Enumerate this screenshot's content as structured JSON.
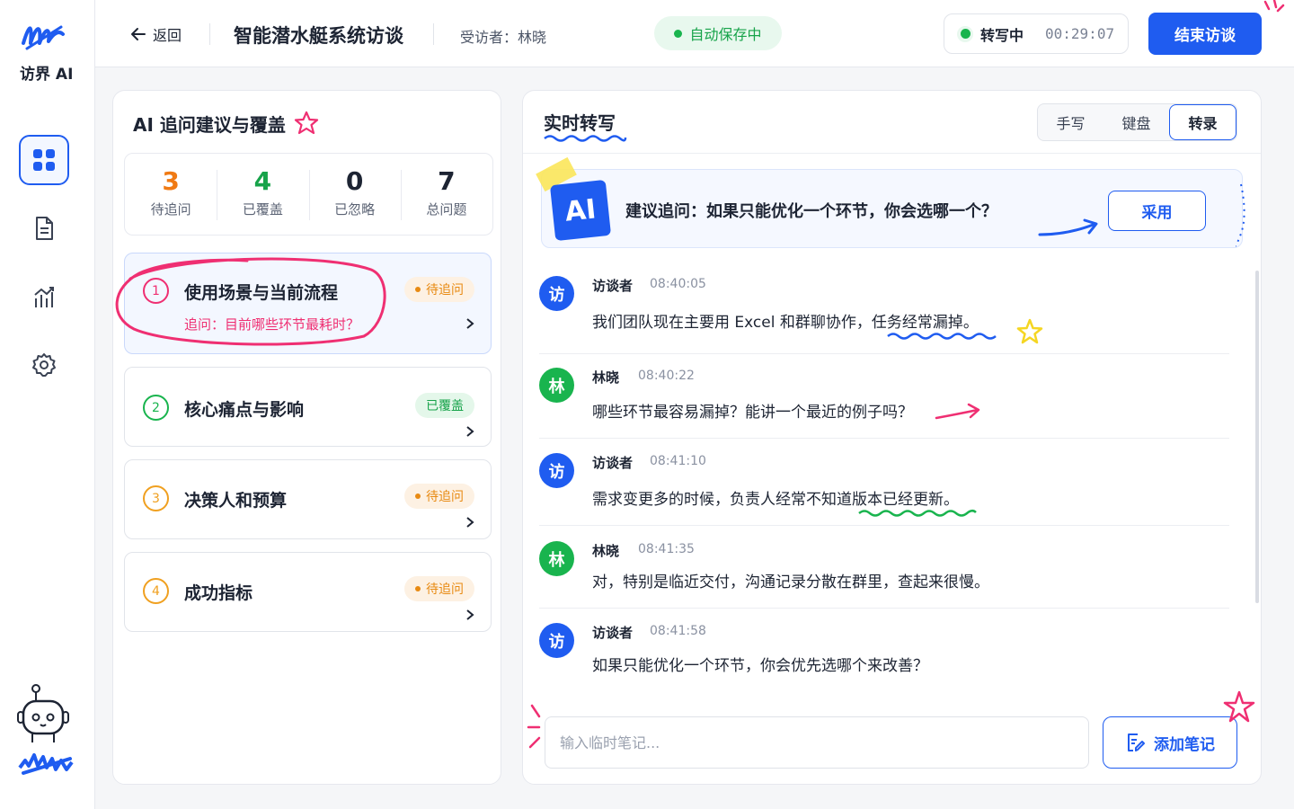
{
  "brand": {
    "name": "访界 AI"
  },
  "sidebar": {
    "items": [
      {
        "icon": "dashboard-icon",
        "active": true
      },
      {
        "icon": "document-icon",
        "active": false
      },
      {
        "icon": "chart-icon",
        "active": false
      },
      {
        "icon": "gear-icon",
        "active": false
      }
    ]
  },
  "topbar": {
    "back_label": "返回",
    "title": "智能潜水艇系统访谈",
    "interviewee": "受访者：林晓",
    "autosave": "自动保存中",
    "recording_label": "转写中",
    "recording_time": "00:29:07",
    "end_button": "结束访谈"
  },
  "coverage": {
    "title": "AI 追问建议与覆盖",
    "stats": [
      {
        "value": "3",
        "label": "待追问",
        "color": "#f07a14"
      },
      {
        "value": "4",
        "label": "已覆盖",
        "color": "#17a34a"
      },
      {
        "value": "0",
        "label": "已忽略",
        "color": "#1d2433"
      },
      {
        "value": "7",
        "label": "总问题",
        "color": "#1d2433"
      }
    ],
    "topics": [
      {
        "num": "1",
        "title": "使用场景与当前流程",
        "sub": "追问：目前哪些环节最耗时？",
        "badge": "待追问",
        "status": "pending",
        "color": "#ef2f72"
      },
      {
        "num": "2",
        "title": "核心痛点与影响",
        "sub": "",
        "badge": "已覆盖",
        "status": "covered",
        "color": "#19b44e"
      },
      {
        "num": "3",
        "title": "决策人和预算",
        "sub": "",
        "badge": "待追问",
        "status": "pending",
        "color": "#f0a020"
      },
      {
        "num": "4",
        "title": "成功指标",
        "sub": "",
        "badge": "待追问",
        "status": "pending",
        "color": "#f0a020"
      }
    ]
  },
  "transcript": {
    "title": "实时转写",
    "modes": [
      {
        "label": "手写",
        "active": false
      },
      {
        "label": "键盘",
        "active": false
      },
      {
        "label": "转录",
        "active": true
      }
    ],
    "suggestion": {
      "badge": "AI",
      "text": "建议追问：如果只能优化一个环节，你会选哪一个？",
      "adopt": "采用"
    },
    "messages": [
      {
        "avatar": "访",
        "name": "访谈者",
        "time": "08:40:05",
        "text": "我们团队现在主要用 Excel 和群聊协作，任务经常漏掉。",
        "side": "interviewer"
      },
      {
        "avatar": "林",
        "name": "林晓",
        "time": "08:40:22",
        "text": "哪些环节最容易漏掉？能讲一个最近的例子吗？",
        "side": "interviewee"
      },
      {
        "avatar": "访",
        "name": "访谈者",
        "time": "08:41:10",
        "text": "需求变更多的时候，负责人经常不知道版本已经更新。",
        "side": "interviewer"
      },
      {
        "avatar": "林",
        "name": "林晓",
        "time": "08:41:35",
        "text": "对，特别是临近交付，沟通记录分散在群里，查起来很慢。",
        "side": "interviewee"
      },
      {
        "avatar": "访",
        "name": "访谈者",
        "time": "08:41:58",
        "text": "如果只能优化一个环节，你会优先选哪个来改善？",
        "side": "interviewer"
      }
    ],
    "note_placeholder": "输入临时笔记...",
    "add_note": "添加笔记"
  },
  "colors": {
    "accent": "#1f5cf0",
    "green": "#19b44e",
    "pink": "#ef2f72",
    "orange": "#f07a14"
  }
}
